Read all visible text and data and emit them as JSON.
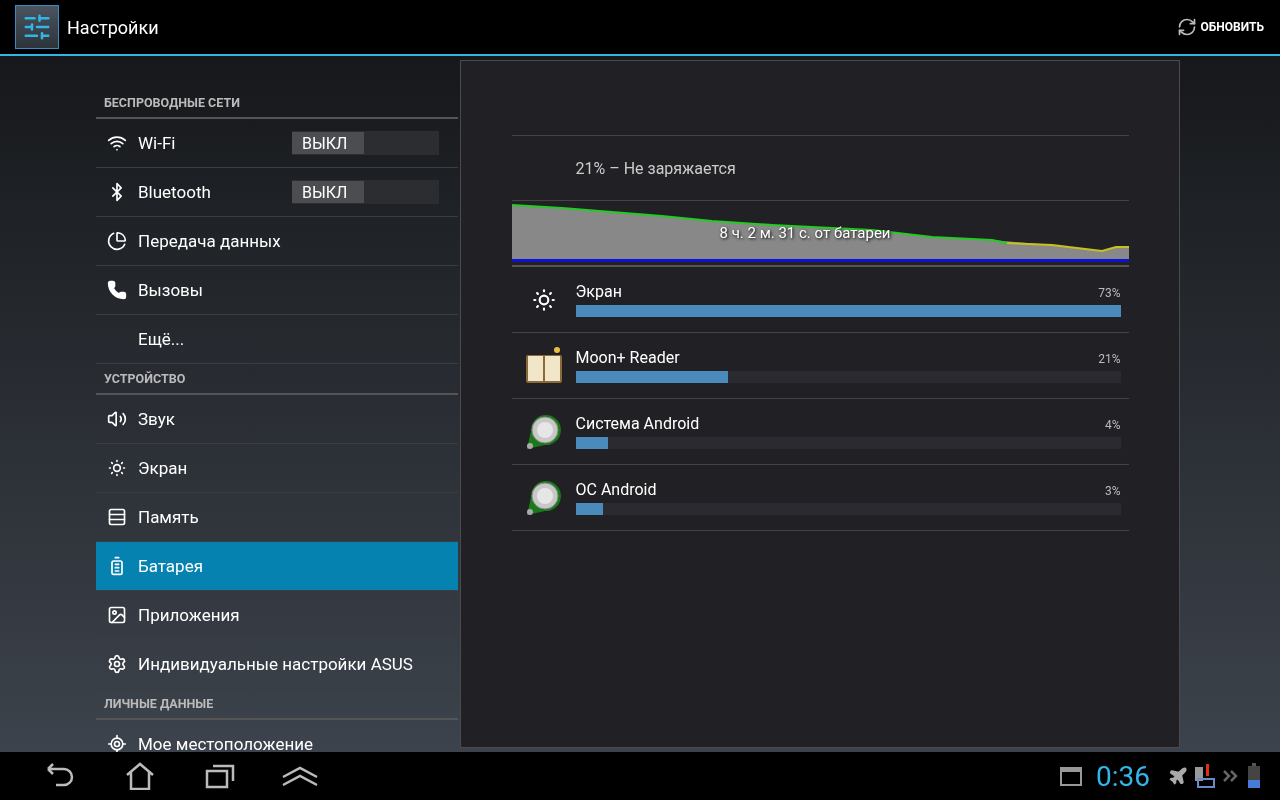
{
  "action_bar": {
    "title": "Настройки",
    "refresh_button": "ОБНОВИТЬ"
  },
  "sidebar": [
    {
      "kind": "header",
      "label": "БЕСПРОВОДНЫЕ СЕТИ"
    },
    {
      "kind": "toggle",
      "label": "Wi-Fi",
      "switch_label": "ВЫКЛ",
      "on": false,
      "selected": false
    },
    {
      "kind": "toggle",
      "label": "Bluetooth",
      "switch_label": "ВЫКЛ",
      "on": false,
      "selected": false
    },
    {
      "kind": "item",
      "label": "Передача данных",
      "selected": false
    },
    {
      "kind": "item",
      "label": "Вызовы",
      "selected": false
    },
    {
      "kind": "item",
      "label": "Ещё...",
      "selected": false
    },
    {
      "kind": "header",
      "label": "УСТРОЙСТВО"
    },
    {
      "kind": "item",
      "label": "Звук",
      "selected": false
    },
    {
      "kind": "item",
      "label": "Экран",
      "selected": false
    },
    {
      "kind": "item",
      "label": "Память",
      "selected": false
    },
    {
      "kind": "item",
      "label": "Батарея",
      "selected": true
    },
    {
      "kind": "item",
      "label": "Приложения",
      "selected": false
    },
    {
      "kind": "item",
      "label": "Индивидуальные настройки ASUS",
      "selected": false
    },
    {
      "kind": "header",
      "label": "ЛИЧНЫЕ ДАННЫЕ"
    },
    {
      "kind": "item",
      "label": "Мое местоположение",
      "selected": false
    }
  ],
  "battery": {
    "status": "21% – Не заряжается",
    "graph_label": "8 ч. 2 м. 31 с. от батареи",
    "usage": [
      {
        "name": "Экран",
        "percent": "73%",
        "level": 1.0
      },
      {
        "name": "Moon+ Reader",
        "percent": "21%",
        "level": 0.28
      },
      {
        "name": "Система Android",
        "percent": "4%",
        "level": 0.06
      },
      {
        "name": "ОС Android",
        "percent": "3%",
        "level": 0.05
      }
    ]
  },
  "status_bar": {
    "time": "0:36"
  }
}
